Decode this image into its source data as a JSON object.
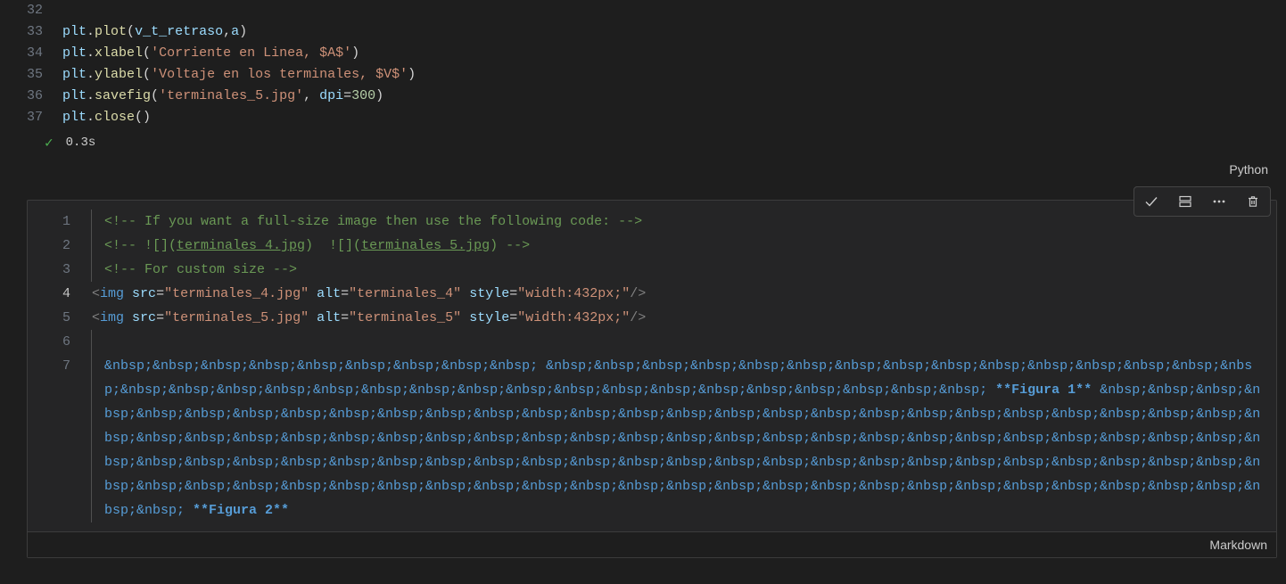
{
  "cell1": {
    "lang": "Python",
    "status_time": "0.3s",
    "check_glyph": "✓",
    "lines": {
      "l32_no": "32",
      "l33_no": "33",
      "l33_obj": "plt",
      "l33_fn": "plot",
      "l33_arg1": "v_t_retraso",
      "l33_arg2": "a",
      "l34_no": "34",
      "l34_obj": "plt",
      "l34_fn": "xlabel",
      "l34_str": "'Corriente en Linea, $A$'",
      "l35_no": "35",
      "l35_obj": "plt",
      "l35_fn": "ylabel",
      "l35_str": "'Voltaje en los terminales, $V$'",
      "l36_no": "36",
      "l36_obj": "plt",
      "l36_fn": "savefig",
      "l36_str": "'terminales_5.jpg'",
      "l36_kw": "dpi",
      "l36_num": "300",
      "l37_no": "37",
      "l37_obj": "plt",
      "l37_fn": "close"
    }
  },
  "toolbar": {
    "accept": "accept-icon",
    "split": "split-icon",
    "more": "more-icon",
    "delete": "delete-icon"
  },
  "cell2": {
    "lang": "Markdown",
    "lines": {
      "l1_no": "1",
      "l1_c": "<!-- If you want a full-size image then use the following code: -->",
      "l2_no": "2",
      "l2_pre": "<!-- ![](",
      "l2_link1": "terminales_4.jpg",
      "l2_mid": ")  ![](",
      "l2_link2": "terminales_5.jpg",
      "l2_post": ") -->",
      "l3_no": "3",
      "l3_c": "<!-- For custom size -->",
      "l4_no": "4",
      "l4_tag_open": "<",
      "l4_tag": "img",
      "l4_a1": "src",
      "l4_v1": "\"terminales_4.jpg\"",
      "l4_a2": "alt",
      "l4_v2": "\"terminales_4\"",
      "l4_a3": "style",
      "l4_v3": "\"width:432px;\"",
      "l4_close": "/>",
      "l5_no": "5",
      "l5_tag_open": "<",
      "l5_tag": "img",
      "l5_a1": "src",
      "l5_v1": "\"terminales_5.jpg\"",
      "l5_a2": "alt",
      "l5_v2": "\"terminales_5\"",
      "l5_a3": "style",
      "l5_v3": "\"width:432px;\"",
      "l5_close": "/>",
      "l6_no": "6",
      "l7_no": "7",
      "l7_nbsp_chunk1": "&nbsp;&nbsp;&nbsp;&nbsp;&nbsp;&nbsp;&nbsp;&nbsp;&nbsp; &nbsp;&nbsp;&nbsp;&nbsp;&nbsp;&nbsp;&nbsp;&nbsp;&nbsp;&nbsp;&nbsp;&nbsp;&nbsp;&nbsp;&nbsp;&nbsp;&nbsp;&nbsp;&nbsp;&nbsp;&nbsp;&nbsp;&nbsp;&nbsp;&nbsp;&nbsp;&nbsp;&nbsp;&nbsp;&nbsp;&nbsp;&nbsp;&nbsp; ",
      "l7_fig1": "**Figura 1**",
      "l7_nbsp_chunk2": " &nbsp;&nbsp;&nbsp;&nbsp;&nbsp;&nbsp;&nbsp;&nbsp;&nbsp;&nbsp;&nbsp;&nbsp;&nbsp;&nbsp;&nbsp;&nbsp;&nbsp;&nbsp;&nbsp;&nbsp;&nbsp;&nbsp;&nbsp;&nbsp;&nbsp;&nbsp;&nbsp;&nbsp;&nbsp;&nbsp;&nbsp;&nbsp;&nbsp;&nbsp;&nbsp;&nbsp;&nbsp;&nbsp;&nbsp;&nbsp;&nbsp;&nbsp;&nbsp;&nbsp;&nbsp;&nbsp;&nbsp;&nbsp;&nbsp;&nbsp;&nbsp;&nbsp;&nbsp;&nbsp;&nbsp;&nbsp;&nbsp;&nbsp;&nbsp;&nbsp;&nbsp;&nbsp;&nbsp;&nbsp;&nbsp;&nbsp;&nbsp;&nbsp;&nbsp;&nbsp;&nbsp;&nbsp;&nbsp;&nbsp;&nbsp;&nbsp;&nbsp;&nbsp;&nbsp;&nbsp;&nbsp;&nbsp;&nbsp;&nbsp;&nbsp;&nbsp;&nbsp;&nbsp;&nbsp;&nbsp;&nbsp;&nbsp;&nbsp;&nbsp;&nbsp;&nbsp;&nbsp;&nbsp;&nbsp;&nbsp;&nbsp; ",
      "l7_fig2": "**Figura 2**"
    }
  }
}
